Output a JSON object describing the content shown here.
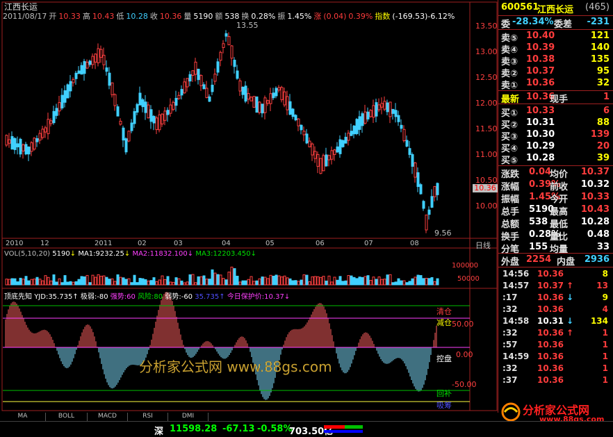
{
  "stock_name": "江西长运",
  "infobar": {
    "date": "2011/08/17",
    "open_label": "开",
    "open": "10.33",
    "high_label": "高",
    "high": "10.43",
    "low_label": "低",
    "low": "10.28",
    "close_label": "收",
    "close": "10.36",
    "vol_label": "量",
    "vol": "5190",
    "amt_label": "额",
    "amt": "538",
    "turn_label": "换",
    "turn": "0.28%",
    "amp_label": "振",
    "amp": "1.45%",
    "chg_label": "涨",
    "chg": "(0.04)",
    "chg_pct": "0.39%",
    "idx_label": "指数",
    "idx": "(-169.53)-6.12%"
  },
  "price_axis": [
    "13.50",
    "13.00",
    "12.50",
    "12.00",
    "11.50",
    "11.00",
    "10.50",
    "10.00"
  ],
  "current_price_tag": "10.36",
  "max_label": "13.55",
  "min_label": "9.56",
  "date_axis": [
    "2010",
    "12",
    "2011",
    "02",
    "03",
    "04",
    "05",
    "06",
    "07",
    "08"
  ],
  "daily_label": "日线",
  "vol_panel": {
    "title": "VOL(5,10,20)",
    "v": "5190",
    "ma1": "MA1:9232.25",
    "ma2": "MA2:11832.100",
    "ma3": "MA3:12203.450",
    "axis_top": "100000",
    "axis_mid": "50000"
  },
  "ind_panel": {
    "name": "顶底先知",
    "yjd": "YJD:35.735",
    "jr": "极弱:-80",
    "qs": "强势:60",
    "fx": "风险:80",
    "rs": "弱势:-60",
    "val": "35.735",
    "bhj": "今日保护价:10.37",
    "axis": [
      "50.00",
      "0.00",
      "-50.00"
    ],
    "labels": {
      "qc": "清仓",
      "jc": "减仓",
      "kp": "控盘",
      "hb": "回补",
      "ch": "吸筹"
    }
  },
  "watermark": "分析家公式网 www.88gs.com",
  "tabs": [
    "MA",
    "BOLL",
    "MACD",
    "RSI",
    "DMI"
  ],
  "quote": {
    "code": "600561",
    "name": "江西长运",
    "count": "(465)",
    "wb_label": "委",
    "wb": "-28.34%",
    "wc_label": "委差",
    "wc": "-231",
    "asks": [
      {
        "label": "卖⑤",
        "price": "10.40",
        "vol": "121"
      },
      {
        "label": "卖④",
        "price": "10.39",
        "vol": "140"
      },
      {
        "label": "卖③",
        "price": "10.38",
        "vol": "135"
      },
      {
        "label": "卖②",
        "price": "10.37",
        "vol": "95"
      },
      {
        "label": "卖①",
        "price": "10.36",
        "vol": "32"
      }
    ],
    "last_label": "最新",
    "last": "10.36",
    "now_label": "现手",
    "now": "1",
    "bids": [
      {
        "label": "买①",
        "price": "10.33",
        "vol": "6"
      },
      {
        "label": "买②",
        "price": "10.31",
        "vol": "88"
      },
      {
        "label": "买③",
        "price": "10.30",
        "vol": "139"
      },
      {
        "label": "买④",
        "price": "10.29",
        "vol": "20"
      },
      {
        "label": "买⑤",
        "price": "10.28",
        "vol": "39"
      }
    ],
    "stats": [
      {
        "l1": "涨跌",
        "v1": "0.04",
        "l2": "均价",
        "v2": "10.37"
      },
      {
        "l1": "涨幅",
        "v1": "0.39%",
        "l2": "前收",
        "v2": "10.32"
      },
      {
        "l1": "振幅",
        "v1": "1.45%",
        "l2": "今开",
        "v2": "10.33"
      },
      {
        "l1": "总手",
        "v1": "5190",
        "l2": "最高",
        "v2": "10.43"
      },
      {
        "l1": "总额",
        "v1": "538",
        "l2": "最低",
        "v2": "10.28"
      },
      {
        "l1": "换手",
        "v1": "0.28%",
        "l2": "量比",
        "v2": "0.48"
      },
      {
        "l1": "分笔",
        "v1": "155",
        "l2": "均量",
        "v2": "33"
      }
    ],
    "outer_label": "外盘",
    "outer": "2254",
    "inner_label": "内盘",
    "inner": "2936",
    "ticks": [
      {
        "t": "14:56",
        "p": "10.36",
        "a": "",
        "q": "8"
      },
      {
        "t": "14:57",
        "p": "10.37",
        "a": "↑",
        "q": "13"
      },
      {
        "t": ":17",
        "p": "10.36",
        "a": "↓",
        "q": "9"
      },
      {
        "t": ":32",
        "p": "10.36",
        "a": "",
        "q": "4"
      },
      {
        "t": "14:58",
        "p": "10.31",
        "a": "↓",
        "q": "134"
      },
      {
        "t": ":32",
        "p": "10.36",
        "a": "↑",
        "q": "1"
      },
      {
        "t": ":57",
        "p": "10.36",
        "a": "",
        "q": "1"
      },
      {
        "t": "14:59",
        "p": "10.36",
        "a": "",
        "q": "1"
      },
      {
        "t": ":32",
        "p": "10.36",
        "a": "",
        "q": "1"
      },
      {
        "t": ":37",
        "p": "10.36",
        "a": "",
        "q": "1"
      }
    ]
  },
  "status": {
    "mkt": "深",
    "idx": "11598.28",
    "chg": "-67.13",
    "pct": "-0.58%",
    "amt": "703.50亿"
  },
  "brand": "分析家公式网",
  "brand_url": "www.88gs.com"
}
